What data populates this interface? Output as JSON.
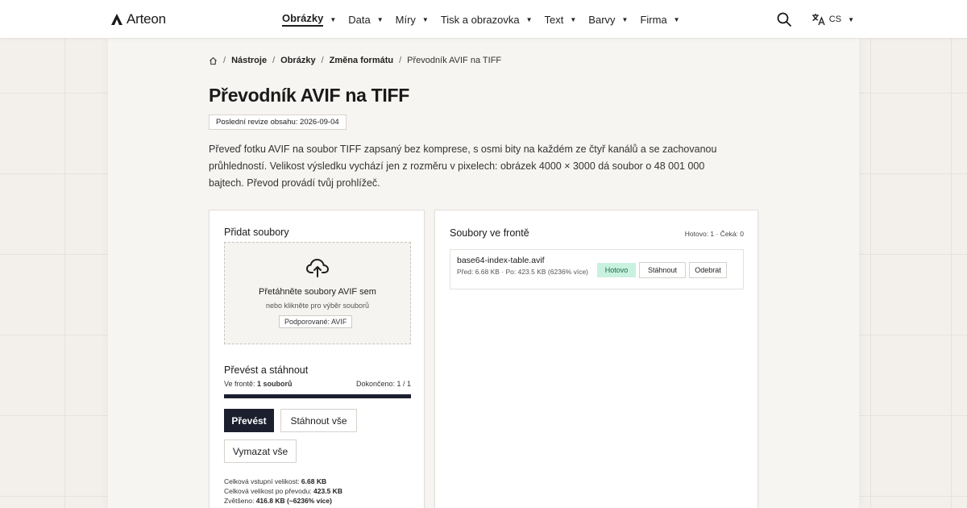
{
  "brand": {
    "name": "Arteon",
    "icon": "logo-mark"
  },
  "nav": {
    "items": [
      {
        "label": "Obrázky",
        "active": true
      },
      {
        "label": "Data",
        "active": false
      },
      {
        "label": "Míry",
        "active": false
      },
      {
        "label": "Tisk a obrazovka",
        "active": false
      },
      {
        "label": "Text",
        "active": false
      },
      {
        "label": "Barvy",
        "active": false
      },
      {
        "label": "Firma",
        "active": false
      }
    ],
    "caret": "▼"
  },
  "header_tools": {
    "search_icon": "search-icon",
    "language_icon": "translate-icon",
    "language": "CS",
    "caret": "▼"
  },
  "breadcrumb": {
    "home_icon": "home-icon",
    "sep": "/",
    "items": [
      "Nástroje",
      "Obrázky",
      "Změna formátu"
    ],
    "current": "Převodník AVIF na TIFF"
  },
  "page": {
    "title": "Převodník AVIF na TIFF",
    "revision": "Poslední revize obsahu: 2026-09-04",
    "intro": "Převeď fotku AVIF na soubor TIFF zapsaný bez komprese, s osmi bity na každém ze čtyř kanálů a se zachovanou průhledností. Velikost výsledku vychází jen z rozměru v pixelech: obrázek 4000 × 3000 dá soubor o 48 001 000 bajtech. Převod provádí tvůj prohlížeč."
  },
  "upload": {
    "title": "Přidat soubory",
    "upload_icon": "cloud-upload-icon",
    "drop_title": "Přetáhněte soubory AVIF sem",
    "drop_sub": "nebo klikněte pro výběr souborů",
    "supported": "Podporované: AVIF"
  },
  "convert": {
    "title": "Převést a stáhnout",
    "queue_label": "Ve frontě:",
    "queue_value": "1 souborů",
    "done_label": "Dokončeno: 1 / 1",
    "progress": 1.0,
    "convert_button": "Převést",
    "download_all_button": "Stáhnout vše",
    "clear_button": "Vymazat vše",
    "stats": {
      "input_label": "Celková vstupní velikost:",
      "input_value": "6.68 KB",
      "output_label": "Celková velikost po převodu:",
      "output_value": "423.5 KB",
      "growth_label": "Zvětšeno:",
      "growth_value": "416.8 KB (~6236% více)"
    }
  },
  "queue": {
    "title": "Soubory ve frontě",
    "count": "Hotovo: 1 · Čeká: 0",
    "files": [
      {
        "name": "base64-index-table.avif",
        "meta": "Před: 6.68 KB · Po: 423.5 KB (6236% více)",
        "status": "Hotovo",
        "download": "Stáhnout",
        "remove": "Odebrat"
      }
    ]
  },
  "colors": {
    "accent": "#1b1f2e",
    "success_bg": "#c9f1df",
    "success_text": "#176b47",
    "page_bg": "#f3f0ec"
  }
}
